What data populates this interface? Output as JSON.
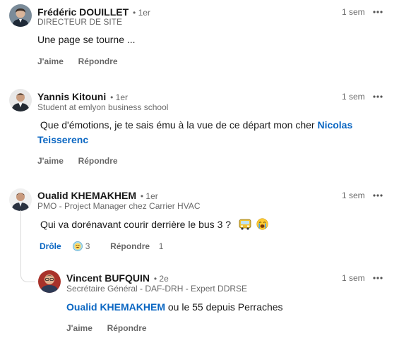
{
  "comments": [
    {
      "author": "Frédéric DOUILLET",
      "degree": "• 1er",
      "headline": "DIRECTEUR DE SITE",
      "time": "1 sem",
      "body": "Une page se tourne ...",
      "like_label": "J'aime",
      "reply_label": "Répondre"
    },
    {
      "author": "Yannis Kitouni",
      "degree": "• 1er",
      "headline": "Student at emlyon business school",
      "time": "1 sem",
      "body_prefix": " Que d'émotions, je te sais ému à la vue de ce départ mon cher ",
      "mention_part1": "Nicolas",
      "mention_part2": "Teisserenc",
      "like_label": "J'aime",
      "reply_label": "Répondre"
    },
    {
      "author": "Oualid KHEMAKHEM",
      "degree": "• 1er",
      "headline": "PMO - Project Manager chez Carrier HVAC",
      "time": "1 sem",
      "body": "Qui va dorénavant courir derrière le bus 3 ? ",
      "reaction_label": "Drôle",
      "reaction_count": "3",
      "reply_label": "Répondre",
      "reply_count": "1"
    }
  ],
  "reply": {
    "author": "Vincent BUFQUIN",
    "degree": "• 2e",
    "headline": "Secrétaire Général - DAF-DRH - Expert DDRSE",
    "time": "1 sem",
    "mention": "Oualid KHEMAKHEM",
    "body_suffix": " ou le 55 depuis Perraches",
    "like_label": "J'aime",
    "reply_label": "Répondre"
  },
  "icons": {
    "more": "ellipsis-icon",
    "bus": "bus-emoji",
    "crying": "crying-face-emoji",
    "funny_reaction": "laughing-reaction-icon"
  }
}
